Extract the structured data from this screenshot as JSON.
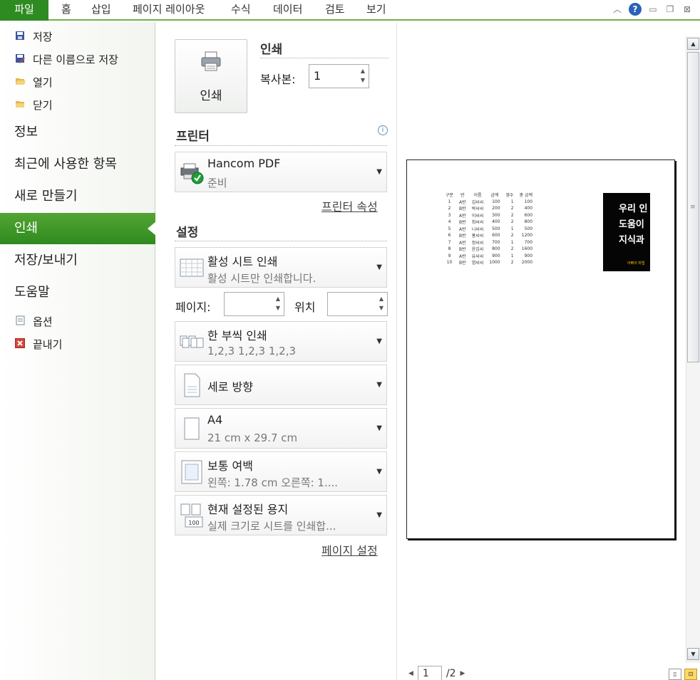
{
  "ribbon": {
    "file_tab": "파일",
    "tabs": [
      "홈",
      "삽입",
      "페이지 레이아웃",
      "수식",
      "데이터",
      "검토",
      "보기"
    ],
    "icons": [
      "chevron-up-icon",
      "help-icon",
      "minimize-icon",
      "restore-icon",
      "close-icon"
    ]
  },
  "nav": {
    "small_top": [
      {
        "label": "저장",
        "icon": "save-icon"
      },
      {
        "label": "다른 이름으로 저장",
        "icon": "save-as-icon"
      },
      {
        "label": "열기",
        "icon": "open-folder-icon"
      },
      {
        "label": "닫기",
        "icon": "close-folder-icon"
      }
    ],
    "big": [
      "정보",
      "최근에 사용한 항목",
      "새로 만들기",
      "인쇄",
      "저장/보내기",
      "도움말"
    ],
    "active": "인쇄",
    "small_bottom": [
      {
        "label": "옵션",
        "icon": "options-icon"
      },
      {
        "label": "끝내기",
        "icon": "exit-icon"
      }
    ]
  },
  "print": {
    "button_label": "인쇄",
    "section_title": "인쇄",
    "copies_label": "복사본:",
    "copies_value": "1"
  },
  "printer": {
    "section_title": "프린터",
    "name": "Hancom PDF",
    "status": "준비",
    "properties_link": "프린터 속성"
  },
  "settings": {
    "section_title": "설정",
    "sheet": {
      "title": "활성 시트 인쇄",
      "sub": "활성 시트만 인쇄합니다."
    },
    "pages_label": "페이지:",
    "pages_value": "",
    "to_label": "위치",
    "to_value": "",
    "collate": {
      "title": "한 부씩 인쇄",
      "sub": "1,2,3     1,2,3     1,2,3"
    },
    "orientation": {
      "title": "세로 방향"
    },
    "paper": {
      "title": "A4",
      "sub": "21 cm x 29.7 cm"
    },
    "margins": {
      "title": "보통 여백",
      "sub": "왼쪽:  1.78 cm     오른쪽:  1...."
    },
    "scaling": {
      "title": "현재 설정된 용지",
      "sub": "실제 크기로 시트를 인쇄합...",
      "icon_text": "100"
    },
    "page_setup_link": "페이지 설정"
  },
  "preview": {
    "table": {
      "headers": [
        "구분",
        "반",
        "이름",
        "금액",
        "영수",
        "총 금액"
      ],
      "rows": [
        [
          "1",
          "A반",
          "김씨씨",
          "100",
          "1",
          "100"
        ],
        [
          "2",
          "B반",
          "박씨씨",
          "200",
          "2",
          "400"
        ],
        [
          "3",
          "A반",
          "이씨씨",
          "300",
          "2",
          "600"
        ],
        [
          "4",
          "B반",
          "최씨씨",
          "400",
          "2",
          "800"
        ],
        [
          "5",
          "A반",
          "니씨씨",
          "500",
          "1",
          "500"
        ],
        [
          "6",
          "B반",
          "홍씨씨",
          "600",
          "2",
          "1200"
        ],
        [
          "7",
          "A반",
          "정씨씨",
          "700",
          "1",
          "700"
        ],
        [
          "8",
          "B반",
          "윤김씨",
          "800",
          "2",
          "1600"
        ],
        [
          "9",
          "A반",
          "유씨씨",
          "900",
          "1",
          "900"
        ],
        [
          "10",
          "B반",
          "염씨씨",
          "1000",
          "2",
          "2000"
        ]
      ]
    },
    "ad_lines": [
      "우리 인",
      "도움이",
      "지식과"
    ],
    "ad_small": "아빠의 마법",
    "page_current": "1",
    "page_total": "/2"
  }
}
